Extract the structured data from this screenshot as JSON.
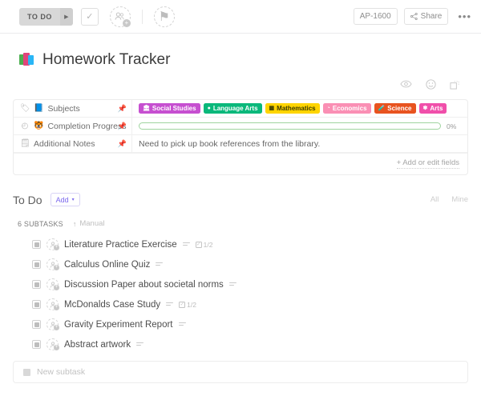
{
  "toolbar": {
    "status_label": "TO DO",
    "status_caret": "▶",
    "check_icon": "✓",
    "assignee_icon": "add-assignee-icon",
    "flag_icon": "⚑",
    "task_id": "AP-1600",
    "share_label": "Share",
    "more_label": "•••"
  },
  "header": {
    "title": "Homework Tracker",
    "actions": {
      "watch_icon": "eye-icon",
      "reaction_icon": "emoji-icon",
      "expand_icon": "expand-icon"
    }
  },
  "fields": {
    "add_or_edit_label": "+ Add or edit fields",
    "pin_icon": "📌",
    "rows": [
      {
        "name": "Subjects",
        "emoji": "📘",
        "type_icon": "tag-icon",
        "tags": [
          {
            "label": "Social Studies",
            "color": "#c64fd0",
            "text": "#ffffff",
            "dot": "🏛"
          },
          {
            "label": "Language Arts",
            "color": "#0ab87b",
            "text": "#ffffff",
            "dot": "●"
          },
          {
            "label": "Mathematics",
            "color": "#ffd400",
            "text": "#3b3b00",
            "dot": "▦"
          },
          {
            "label": "Economics",
            "color": "#fa8fb4",
            "text": "#ffffff",
            "dot": "◔"
          },
          {
            "label": "Science",
            "color": "#e8531f",
            "text": "#ffffff",
            "dot": "🧪"
          },
          {
            "label": "Arts",
            "color": "#f04faa",
            "text": "#ffffff",
            "dot": "✾"
          }
        ]
      },
      {
        "name": "Completion Progress",
        "emoji": "🐯",
        "type_icon": "progress-icon",
        "percent_label": "0%",
        "percent_value": 0
      },
      {
        "name": "Additional Notes",
        "emoji": "",
        "type_icon": "text-icon",
        "note": "Need to pick up book references from the library."
      }
    ]
  },
  "todo": {
    "title": "To Do",
    "add_label": "Add",
    "add_caret": "▾",
    "filter_all": "All",
    "filter_mine": "Mine",
    "subtask_count_label": "6 SUBTASKS",
    "sort_arrow": "↑",
    "sort_label": "Manual",
    "subtasks": [
      {
        "title": "Literature Practice Exercise",
        "has_desc": true,
        "checklist": "1/2"
      },
      {
        "title": "Calculus Online Quiz",
        "has_desc": true,
        "checklist": ""
      },
      {
        "title": "Discussion Paper about societal norms",
        "has_desc": true,
        "checklist": ""
      },
      {
        "title": "McDonalds Case Study",
        "has_desc": true,
        "checklist": "1/2"
      },
      {
        "title": "Gravity Experiment Report",
        "has_desc": true,
        "checklist": ""
      },
      {
        "title": "Abstract artwork",
        "has_desc": true,
        "checklist": ""
      }
    ],
    "new_subtask_placeholder": "New subtask"
  }
}
